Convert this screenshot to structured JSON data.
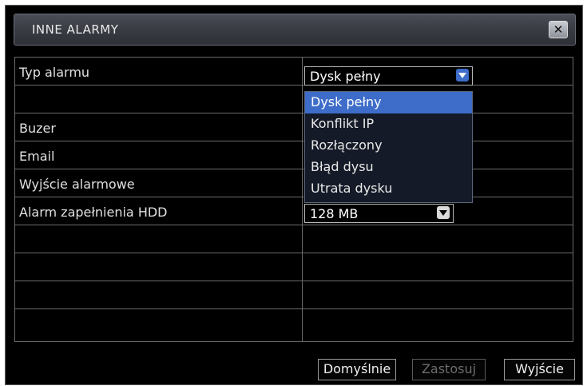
{
  "dialog": {
    "title": "INNE ALARMY",
    "close_label": "✕"
  },
  "form": {
    "rows": [
      {
        "label": "Typ alarmu"
      },
      {
        "label": ""
      },
      {
        "label": "Buzer"
      },
      {
        "label": "Email"
      },
      {
        "label": "Wyjście alarmowe"
      },
      {
        "label": "Alarm zapełnienia HDD"
      },
      {
        "label": ""
      },
      {
        "label": ""
      },
      {
        "label": ""
      },
      {
        "label": ""
      }
    ],
    "alarm_type_select": {
      "value": "Dysk pełny",
      "options": [
        "Dysk pełny",
        "Konflikt IP",
        "Rozłączony",
        "Błąd dysu",
        "Utrata dysku"
      ]
    },
    "hdd_threshold_select": {
      "value": "128 MB"
    }
  },
  "buttons": {
    "default": "Domyślnie",
    "apply": "Zastosuj",
    "exit": "Wyjście"
  },
  "colors": {
    "highlight": "#3d6dc9",
    "background": "#000000",
    "grid_line": "#6b6b6b"
  }
}
